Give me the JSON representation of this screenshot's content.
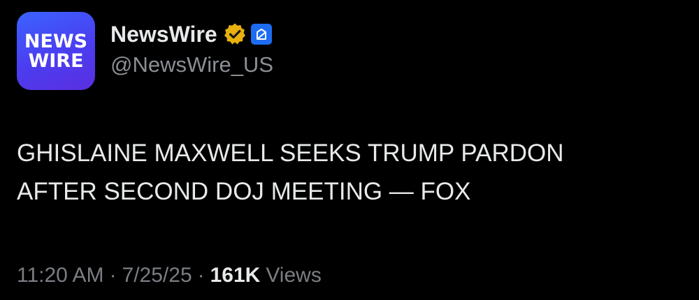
{
  "author": {
    "avatar_text_line1": "NEWS",
    "avatar_text_line2": "WIRE",
    "display_name": "NewsWire",
    "handle": "@NewsWire_US",
    "verified_badge_color": "#e8b10f",
    "affiliate_badge_color": "#1d6cf2",
    "icons": [
      "verified-badge-icon",
      "affiliate-badge-icon"
    ]
  },
  "post": {
    "text": "GHISLAINE MAXWELL SEEKS TRUMP PARDON\nAFTER SECOND DOJ MEETING — FOX"
  },
  "meta": {
    "time": "11:20 AM",
    "separator": "·",
    "date": "7/25/25",
    "views_count": "161K",
    "views_label": "Views"
  },
  "colors": {
    "background": "#000000",
    "primary_text": "#e7e9ea",
    "secondary_text": "#7a7e83",
    "avatar_gradient_start": "#3b63ff",
    "avatar_gradient_end": "#5a2fe0"
  }
}
